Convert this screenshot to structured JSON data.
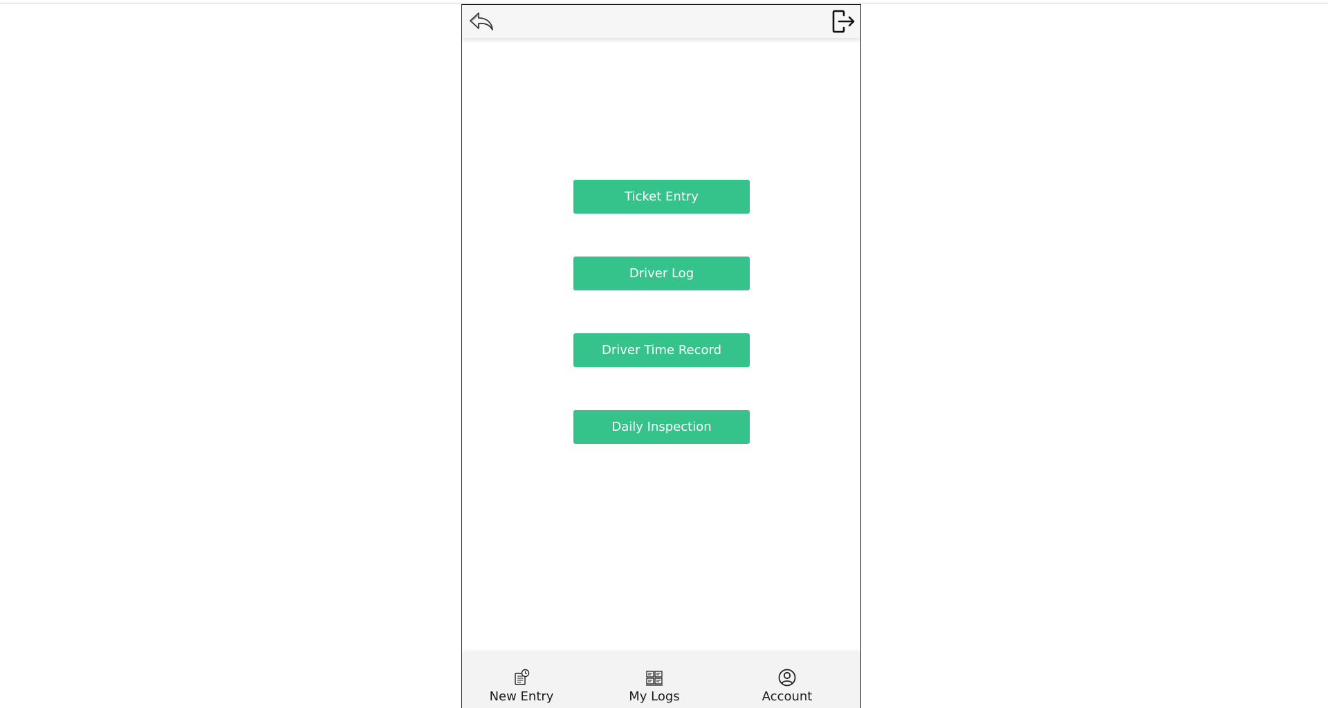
{
  "header": {
    "back_icon": "reply-arrow-icon",
    "logout_icon": "logout-icon"
  },
  "menu": {
    "buttons": [
      {
        "label": "Ticket Entry"
      },
      {
        "label": "Driver Log"
      },
      {
        "label": "Driver Time Record"
      },
      {
        "label": "Daily Inspection"
      }
    ],
    "button_color": "#35c28b",
    "button_text_color": "#ffffff"
  },
  "bottom_nav": {
    "items": [
      {
        "label": "New Entry",
        "icon": "new-entry-icon"
      },
      {
        "label": "My Logs",
        "icon": "logs-icon"
      },
      {
        "label": "Account",
        "icon": "account-icon"
      }
    ]
  }
}
